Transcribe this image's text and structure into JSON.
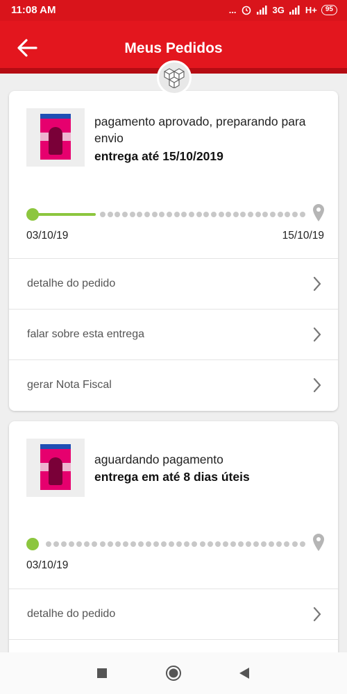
{
  "status_bar": {
    "time": "11:08 AM",
    "dots": "...",
    "network": "3G",
    "network2": "H+",
    "battery": "95"
  },
  "app_bar": {
    "title": "Meus Pedidos"
  },
  "orders": [
    {
      "status": "pagamento aprovado, preparando para envio",
      "delivery": "entrega até 15/10/2019",
      "start_date": "03/10/19",
      "end_date": "15/10/19",
      "progress_percent": 25,
      "actions": [
        "detalhe do pedido",
        "falar sobre esta entrega",
        "gerar Nota Fiscal"
      ]
    },
    {
      "status": "aguardando pagamento",
      "delivery": "entrega em até 8 dias úteis",
      "start_date": "03/10/19",
      "progress_percent": 0,
      "actions": [
        "detalhe do pedido"
      ]
    }
  ],
  "icons": [
    "back-arrow-icon",
    "boxes-icon",
    "location-pin-icon",
    "chevron-right-icon",
    "stop-icon",
    "home-icon",
    "back-triangle-icon"
  ],
  "colors": {
    "brand_red": "#e3161e",
    "progress_green": "#8cc63e"
  }
}
